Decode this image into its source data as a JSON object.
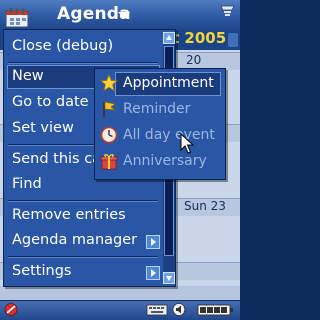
{
  "titlebar": {
    "app_title": "Agenda",
    "app_icon": "calendar-book-icon",
    "signal_icon": "network-signal-icon"
  },
  "calendar": {
    "month_visible": "t",
    "year": "2005",
    "dates": [
      "20",
      "Sun 23"
    ]
  },
  "menu": {
    "items": [
      {
        "label": "Close (debug)",
        "submenu": false
      },
      {
        "label": "New",
        "submenu": true
      },
      {
        "label": "Go to date",
        "submenu": false
      },
      {
        "label": "Set view",
        "submenu": false
      },
      {
        "label": "Send this ca",
        "submenu": false
      },
      {
        "label": "Find",
        "submenu": false
      },
      {
        "label": "Remove entries",
        "submenu": false
      },
      {
        "label": "Agenda manager",
        "submenu": true
      },
      {
        "label": "Settings",
        "submenu": true
      }
    ],
    "selected": "New"
  },
  "submenu": {
    "items": [
      {
        "label": "Appointment",
        "icon": "star-icon"
      },
      {
        "label": "Reminder",
        "icon": "flag-icon"
      },
      {
        "label": "All day event",
        "icon": "clock-icon"
      },
      {
        "label": "Anniversary",
        "icon": "gift-icon"
      }
    ],
    "selected": "Appointment"
  },
  "statusbar": {
    "icons": [
      "no-entry-icon",
      "keyboard-icon",
      "speaker-icon",
      "battery-icon"
    ]
  },
  "colors": {
    "menu_bg": "#2a56a6",
    "highlight": "#1a3b7c",
    "month_text": "#ffe45c"
  }
}
